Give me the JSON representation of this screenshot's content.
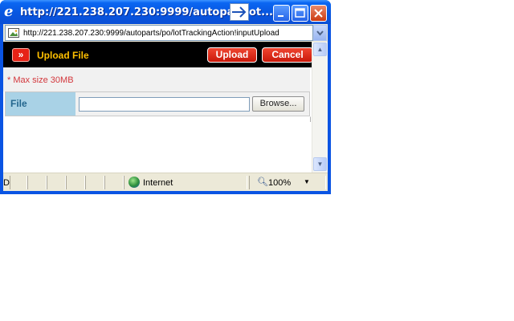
{
  "window": {
    "title": "http://221.238.207.230:9999/autoparts/",
    "title_suffix": "ot...",
    "url": "http://221.238.207.230:9999/autoparts/po/lotTrackingAction!inputUpload"
  },
  "popup": {
    "title": "Upload File",
    "upload_label": "Upload",
    "cancel_label": "Cancel",
    "max_size_note": "* Max size 30MB",
    "file_label": "File",
    "browse_label": "Browse..."
  },
  "statusbar": {
    "status_text": "D",
    "zone": "Internet",
    "zoom": "100%"
  },
  "colors": {
    "header_bg": "#000000",
    "header_title": "#ffc000",
    "button_red": "#d9261a",
    "note_red": "#d3373c",
    "label_bg": "#a9d2e6",
    "label_text": "#23668e"
  }
}
